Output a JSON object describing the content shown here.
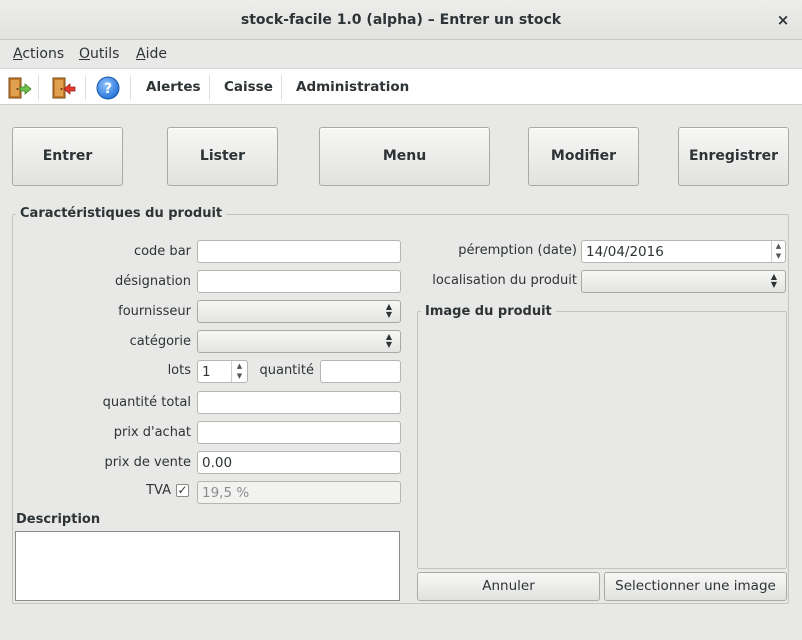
{
  "window": {
    "title": "stock-facile 1.0 (alpha) – Entrer un stock",
    "close_glyph": "×"
  },
  "menubar": {
    "items": [
      {
        "label_u": "A",
        "label_rest": "ctions"
      },
      {
        "label_u": "O",
        "label_rest": "utils"
      },
      {
        "label_u": "A",
        "label_rest": "ide"
      }
    ]
  },
  "toolbar": {
    "icons": [
      "enter-door-icon",
      "exit-door-icon",
      "help-icon"
    ],
    "help_glyph": "?",
    "links": [
      "Alertes",
      "Caisse",
      "Administration"
    ]
  },
  "actions": {
    "enter": "Entrer",
    "list": "Lister",
    "menu": "Menu",
    "modify": "Modifier",
    "save": "Enregistrer"
  },
  "product": {
    "section_title": "Caractéristiques du produit",
    "labels": {
      "barcode": "code bar",
      "designation": "désignation",
      "supplier": "fournisseur",
      "category": "catégorie",
      "lots": "lots",
      "quantity": "quantité",
      "total_quantity": "quantité total",
      "purchase_price": "prix d'achat",
      "sale_price": "prix de vente",
      "vat": "TVA",
      "expiry": "péremption (date)",
      "location": "localisation du produit"
    },
    "values": {
      "barcode": "",
      "designation": "",
      "supplier": "",
      "category": "",
      "lots": "1",
      "quantity": "",
      "total_quantity": "",
      "purchase_price": "",
      "sale_price": "0.00",
      "vat_rate": "19,5 %",
      "vat_checked": true,
      "expiry": "14/04/2016",
      "location": ""
    },
    "description_label": "Description",
    "image_section_title": "Image du produit",
    "cancel_button": "Annuler",
    "select_image_button": "Selectionner une image",
    "check_glyph": "✓"
  },
  "colors": {
    "window_bg": "#e8e8e7",
    "toolbar_bg": "#ffffff"
  }
}
